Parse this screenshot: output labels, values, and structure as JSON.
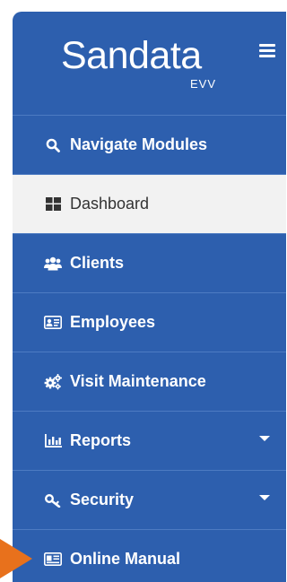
{
  "brand": {
    "name": "Sandata",
    "subtitle": "EVV"
  },
  "colors": {
    "sidebar": "#2d5fae",
    "divider": "#4d7bc2",
    "active_background": "#f2f2f2",
    "active_text": "#333333",
    "pointer_arrow": "#e8711c"
  },
  "nav": {
    "items": [
      {
        "label": "Navigate Modules",
        "icon": "search-icon"
      },
      {
        "label": "Dashboard",
        "icon": "dashboard-icon",
        "active": true
      },
      {
        "label": "Clients",
        "icon": "users-icon"
      },
      {
        "label": "Employees",
        "icon": "id-card-icon"
      },
      {
        "label": "Visit Maintenance",
        "icon": "cogs-icon"
      },
      {
        "label": "Reports",
        "icon": "bar-chart-icon",
        "has_submenu": true
      },
      {
        "label": "Security",
        "icon": "key-icon",
        "has_submenu": true
      },
      {
        "label": "Online Manual",
        "icon": "manual-icon"
      }
    ]
  }
}
